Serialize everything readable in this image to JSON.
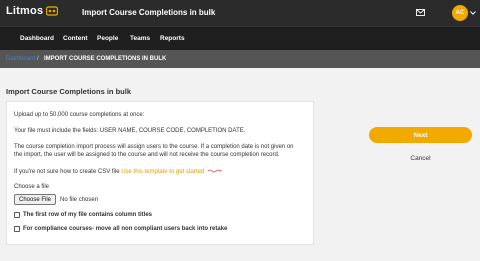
{
  "header": {
    "logo_text": "Litmos",
    "title": "Import Course Completions in bulk",
    "avatar_initials": "AC",
    "brand_color": "#f2a900"
  },
  "nav": {
    "items": [
      "Dashboard",
      "Content",
      "People",
      "Teams",
      "Reports"
    ]
  },
  "breadcrumb": {
    "link": "Dashboard",
    "separator": "/",
    "current": "IMPORT COURSE COMPLETIONS IN BULK"
  },
  "main": {
    "heading": "Import Course Completions in bulk",
    "upload_limit": "Upload up to 50,000 course completions at once:",
    "fields_note": "Your file must include the fields: USER NAME, COURSE CODE, COMPLETION DATE.",
    "process_note_line1": "The course completion import process will assign users to the course. If a completion date is not given on",
    "process_note_line2": "the import, the user will be assigned to the course and will not receive the course completion record.",
    "template_prefix": "If you're not sure how to create CSV file",
    "template_link": "Use this template to get started",
    "choose_file_label": "Choose a file",
    "file_button": "Choose File",
    "file_status": "No file chosen",
    "checkbox_column_titles": "The first row of my file contains column titles",
    "checkbox_compliance": "For compliance courses- move all non compliant users back into retake"
  },
  "actions": {
    "next": "Next",
    "cancel": "Cancel"
  }
}
